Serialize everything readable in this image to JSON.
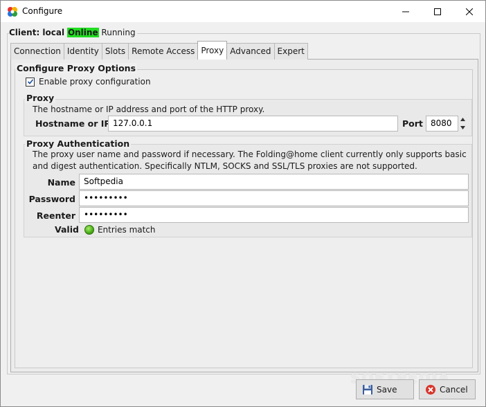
{
  "window": {
    "title": "Configure"
  },
  "client": {
    "label": "Client: local",
    "status": "Online",
    "state": "Running"
  },
  "tabs": [
    {
      "label": "Connection"
    },
    {
      "label": "Identity"
    },
    {
      "label": "Slots"
    },
    {
      "label": "Remote Access"
    },
    {
      "label": "Proxy",
      "active": true
    },
    {
      "label": "Advanced"
    },
    {
      "label": "Expert"
    }
  ],
  "proxy_options": {
    "title": "Configure Proxy Options",
    "enable_label": "Enable proxy configuration",
    "enable_checked": true,
    "proxy": {
      "title": "Proxy",
      "description": "The hostname or IP address and port of the HTTP proxy.",
      "hostname_label": "Hostname or IP",
      "hostname_value": "127.0.0.1",
      "port_label": "Port",
      "port_value": "8080"
    },
    "auth": {
      "title": "Proxy Authentication",
      "description_1": "The proxy user name and password if necessary.  The Folding@home client currently only supports basic",
      "description_2": "and digest authentication.  Specifically NTLM, SOCKS and SSL/TLS proxies are not supported.",
      "name_label": "Name",
      "name_value": "Softpedia",
      "password_label": "Password",
      "password_value": "•••••••••",
      "reenter_label": "Reenter",
      "reenter_value": "•••••••••",
      "valid_label": "Valid",
      "valid_text": "Entries match"
    }
  },
  "buttons": {
    "save": "Save",
    "cancel": "Cancel"
  },
  "watermark": "SOFTPEDIA",
  "colors": {
    "online": "#22dd22",
    "valid_led": "#4fb11c"
  }
}
